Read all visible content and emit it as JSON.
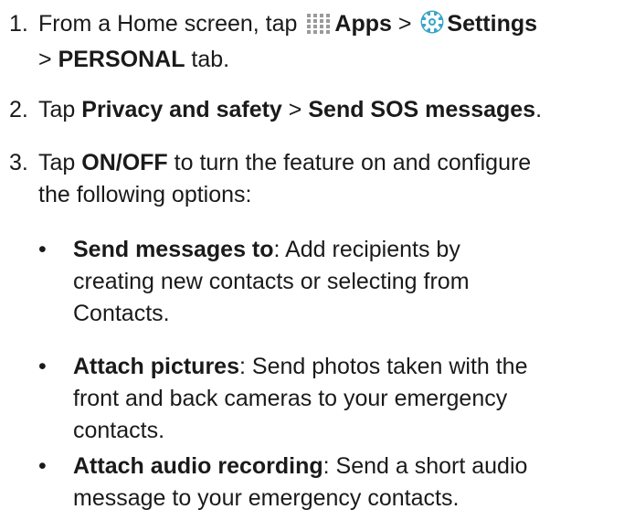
{
  "steps": [
    {
      "num": "1.",
      "pre": "From a Home screen, tap",
      "apps": "Apps",
      "sep1": ">",
      "settings": "Settings",
      "sep2": ">",
      "personal": "PERSONAL",
      "post": "tab."
    },
    {
      "num": "2.",
      "pre": "Tap",
      "privacy": "Privacy and safety",
      "sep": ">",
      "sos": "Send SOS messages",
      "post": "."
    },
    {
      "num": "3.",
      "pre": "Tap",
      "onoff": "ON/OFF",
      "line1_post": "to turn the feature on and configure",
      "line2": "the following options:"
    }
  ],
  "options": [
    {
      "bullet": "•",
      "title": "Send messages to",
      "colon": ":",
      "line1": "Add recipients by",
      "line2": "creating new contacts or selecting from",
      "line3": "Contacts."
    },
    {
      "bullet": "•",
      "title": "Attach pictures",
      "colon": ":",
      "line1": "Send photos taken with the",
      "line2": "front and back cameras to your emergency",
      "line3": "contacts."
    },
    {
      "bullet": "•",
      "title": "Attach audio recording",
      "colon": ":",
      "line1": "Send a short audio",
      "line2": "message to your emergency contacts."
    }
  ],
  "icons": {
    "apps": "apps-grid-icon",
    "settings": "settings-gear-icon"
  },
  "colors": {
    "text": "#1a1a1a",
    "apps_icon": "#9a9a9a",
    "settings_icon": "#3aa6c9"
  }
}
